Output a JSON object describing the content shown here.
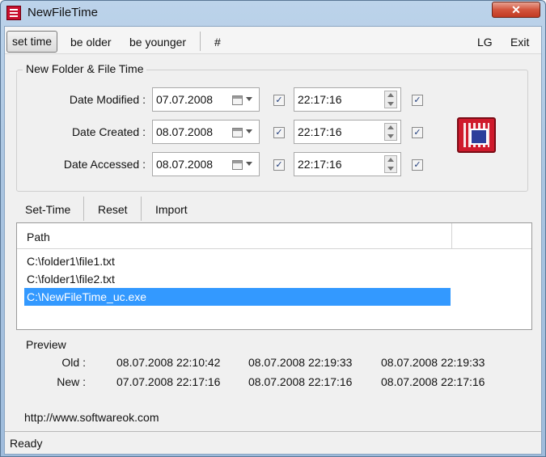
{
  "window": {
    "title": "NewFileTime",
    "close_label": "✕"
  },
  "toolbar": {
    "set_time": "set time",
    "be_older": "be older",
    "be_younger": "be younger",
    "hash": "#",
    "lg": "LG",
    "exit": "Exit"
  },
  "group": {
    "title": "New Folder & File Time",
    "rows": [
      {
        "label": "Date Modified :",
        "date": "07.07.2008",
        "date_checked": true,
        "time": "22:17:16",
        "time_checked": true
      },
      {
        "label": "Date Created :",
        "date": "08.07.2008",
        "date_checked": true,
        "time": "22:17:16",
        "time_checked": true
      },
      {
        "label": "Date Accessed :",
        "date": "08.07.2008",
        "date_checked": true,
        "time": "22:17:16",
        "time_checked": true
      }
    ]
  },
  "actions": {
    "set_time": "Set-Time",
    "reset": "Reset",
    "import": "Import"
  },
  "list": {
    "column_path": "Path",
    "rows": [
      {
        "path": "C:\\folder1\\file1.txt",
        "selected": false
      },
      {
        "path": "C:\\folder1\\file2.txt",
        "selected": false
      },
      {
        "path": "C:\\NewFileTime_uc.exe",
        "selected": true
      }
    ]
  },
  "preview": {
    "title": "Preview",
    "old_label": "Old :",
    "new_label": "New :",
    "old": [
      "08.07.2008 22:10:42",
      "08.07.2008 22:19:33",
      "08.07.2008 22:19:33"
    ],
    "new": [
      "07.07.2008 22:17:16",
      "08.07.2008 22:17:16",
      "08.07.2008 22:17:16"
    ]
  },
  "url": "http://www.softwareok.com",
  "status": "Ready",
  "colors": {
    "selection": "#3399ff",
    "close_button": "#c23a22",
    "app_icon": "#c8102e"
  },
  "icons": {
    "app": "newfiletime-app-icon",
    "calendar": "calendar-dropdown-icon",
    "spinner": "spinner-icon",
    "apply": "set-time-big-icon"
  }
}
